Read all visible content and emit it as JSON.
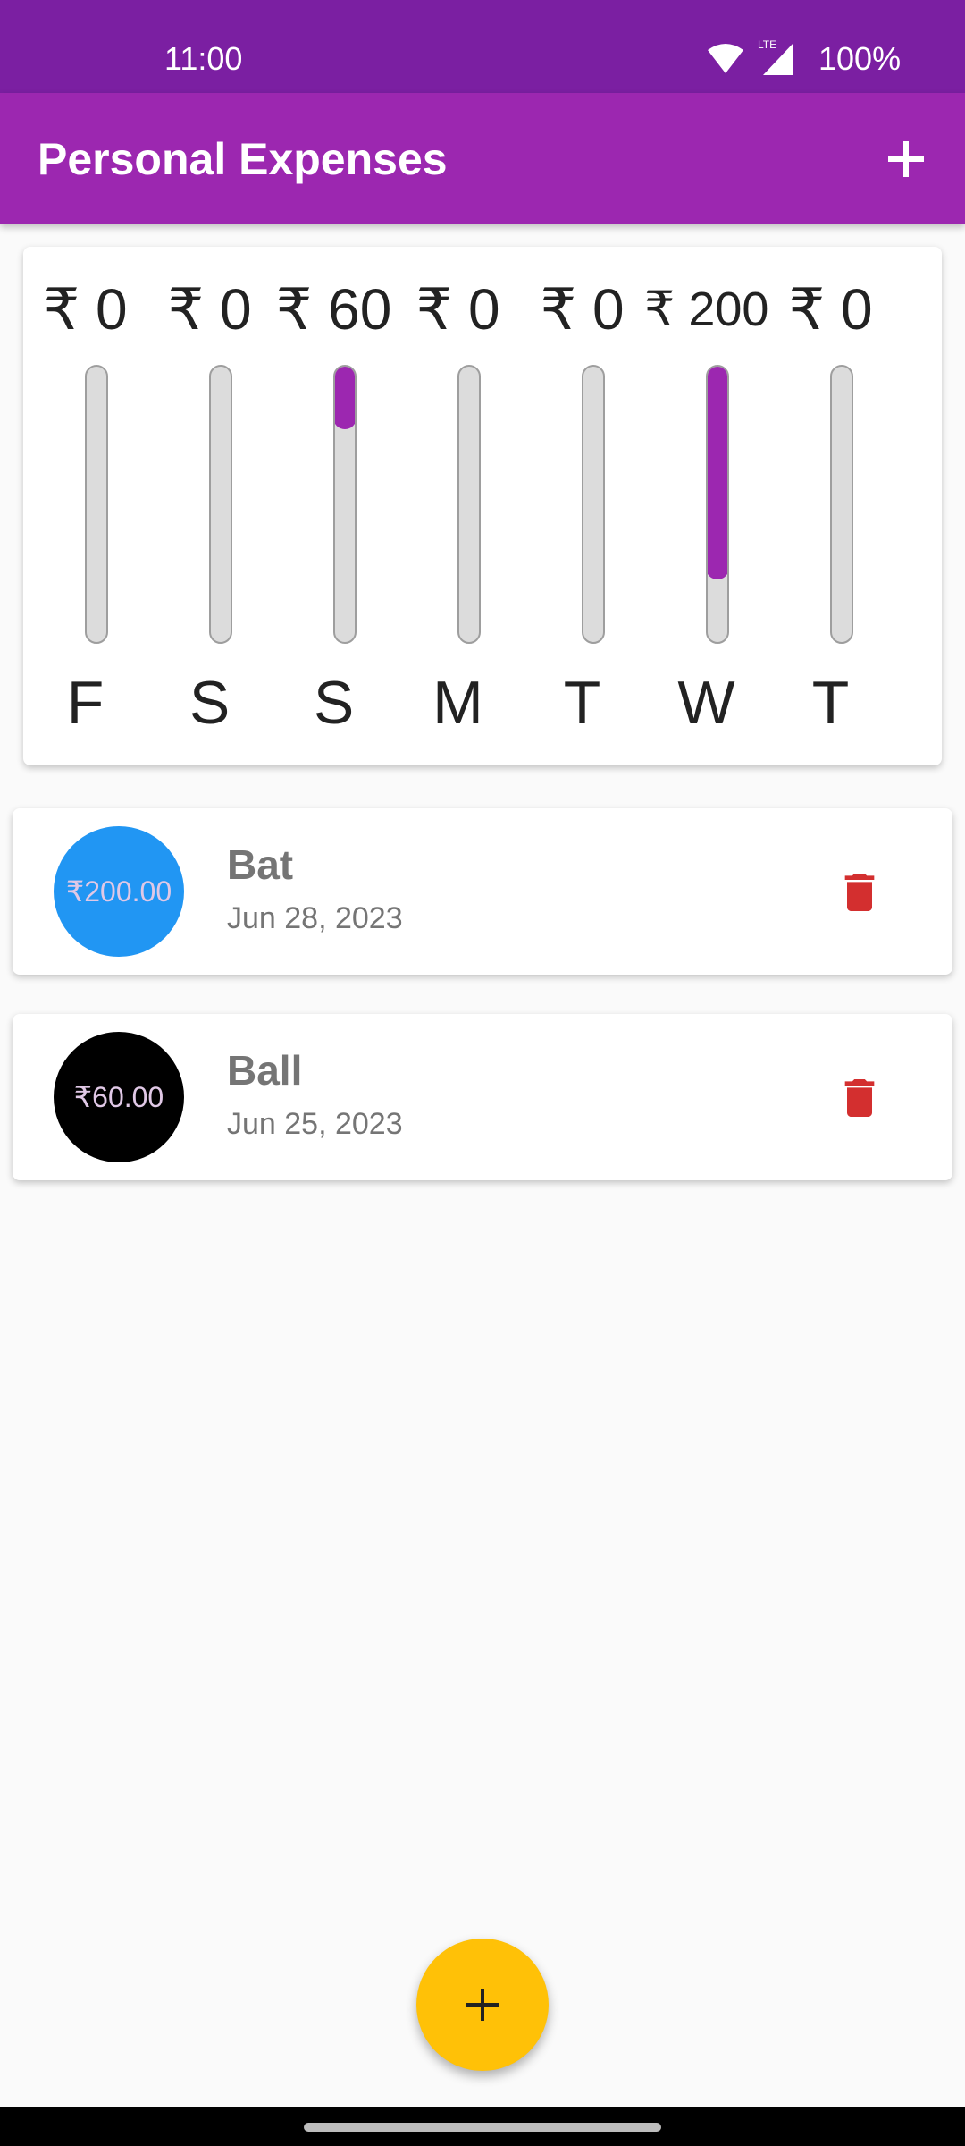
{
  "status_bar": {
    "time": "11:00",
    "battery": "100%",
    "network_label": "LTE"
  },
  "app_bar": {
    "title": "Personal Expenses"
  },
  "chart": {
    "bars": [
      {
        "amount": "₹ 0",
        "day": "F",
        "fill": 0.0
      },
      {
        "amount": "₹ 0",
        "day": "S",
        "fill": 0.0
      },
      {
        "amount": "₹ 60",
        "day": "S",
        "fill": 0.23
      },
      {
        "amount": "₹ 0",
        "day": "M",
        "fill": 0.0
      },
      {
        "amount": "₹ 0",
        "day": "T",
        "fill": 0.0
      },
      {
        "amount": "₹ 200",
        "day": "W",
        "fill": 0.77
      },
      {
        "amount": "₹ 0",
        "day": "T",
        "fill": 0.0
      }
    ]
  },
  "transactions": [
    {
      "amount": "₹200.00",
      "title": "Bat",
      "date": "Jun 28, 2023",
      "avatar_color": "#2196f3"
    },
    {
      "amount": "₹60.00",
      "title": "Ball",
      "date": "Jun 25, 2023",
      "avatar_color": "#000000"
    }
  ],
  "colors": {
    "primary": "#9c27b0",
    "primary_dark": "#7b1fa2",
    "accent": "#ffc107",
    "delete": "#d32f2f"
  },
  "icons": {
    "app_bar_action": "add-icon",
    "fab": "add-icon",
    "row_action": "delete-icon"
  }
}
